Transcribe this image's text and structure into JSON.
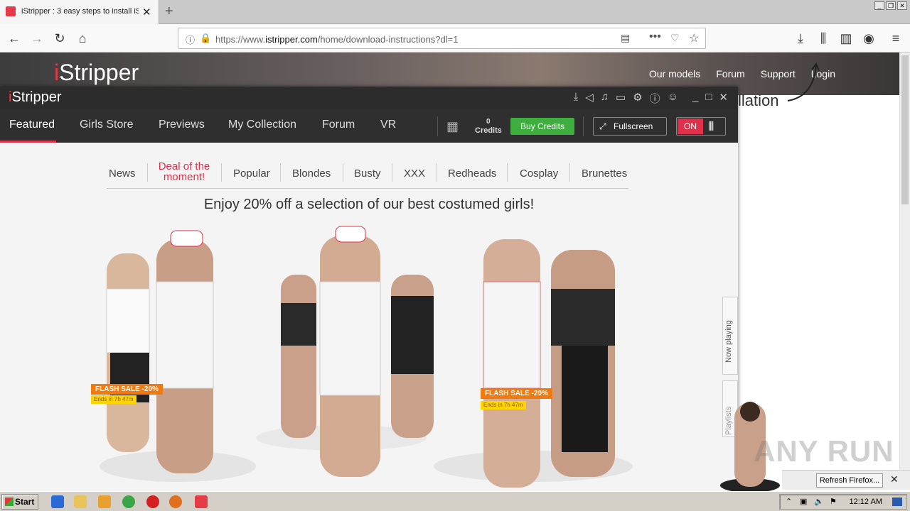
{
  "browser": {
    "tab_title": "iStripper : 3 easy steps to install iS",
    "url_prefix": "https://www.",
    "url_domain": "istripper.com",
    "url_path": "/home/download-instructions?dl=1"
  },
  "site": {
    "logo_i": "i",
    "logo_rest": "Stripper",
    "nav": [
      "Our models",
      "Forum",
      "Support",
      "Login"
    ],
    "install_fragment": "llation"
  },
  "app": {
    "logo_i": "i",
    "logo_rest": "Stripper",
    "nav": [
      "Featured",
      "Girls Store",
      "Previews",
      "My Collection",
      "Forum",
      "VR"
    ],
    "credits_count": "0",
    "credits_label": "Credits",
    "buy_credits": "Buy Credits",
    "fullscreen": "Fullscreen",
    "toggle_on": "ON",
    "subnav": [
      "News",
      "Deal of the moment!",
      "Popular",
      "Blondes",
      "Busty",
      "XXX",
      "Redheads",
      "Cosplay",
      "Brunettes"
    ],
    "headline": "Enjoy 20% off a selection of our best costumed girls!",
    "flash_sale": "FLASH SALE -20%",
    "ends_in": "Ends in 7h 47m",
    "side_now_playing": "Now playing",
    "side_playlists": "Playlists"
  },
  "notification": {
    "refresh_button": "Refresh Firefox..."
  },
  "taskbar": {
    "start": "Start",
    "clock": "12:12 AM"
  },
  "watermark": "ANY RUN",
  "colors": {
    "accent": "#e0304a",
    "buy_green": "#3eae3e",
    "flash_orange": "#f07a10"
  }
}
